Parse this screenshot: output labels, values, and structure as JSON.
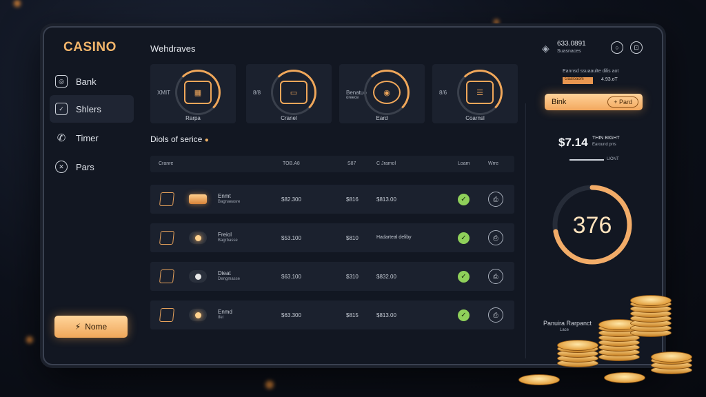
{
  "sidebar": {
    "brand": "CASINO",
    "items": [
      {
        "label": "Bank",
        "icon": "bank-icon"
      },
      {
        "label": "Shlers",
        "icon": "document-icon"
      },
      {
        "label": "Timer",
        "icon": "phone-icon"
      },
      {
        "label": "Pars",
        "icon": "tools-icon"
      }
    ],
    "home_button": {
      "label": "Nome",
      "icon": "bolt-icon"
    }
  },
  "header": {
    "title": "Wehdraves",
    "balance": "633.0891",
    "balance_sub": "Suasnaces"
  },
  "cards": [
    {
      "small": "XMIT",
      "caption": "Rarpa",
      "icon": "safe-icon"
    },
    {
      "small": "8/8",
      "caption": "Cranel",
      "icon": "card-icon"
    },
    {
      "small": "Benatuo",
      "small_sub": "oreece",
      "caption": "Eard",
      "icon": "piggy-icon"
    },
    {
      "small": "8/6",
      "caption": "Coarnsl",
      "icon": "wallet-icon"
    }
  ],
  "section_title": "Diols of serice",
  "table": {
    "headers": [
      "Cranre",
      "TOB.A8",
      "S87",
      "C Jramol",
      "Loam",
      "Wrre"
    ],
    "rows": [
      {
        "name": "Enmt",
        "name_sub": "Bagnaeasre",
        "amount": "$82.300",
        "fee": "$816",
        "detail": "$813.00"
      },
      {
        "name": "Freiol",
        "name_sub": "Bagrbasse",
        "amount": "$53.100",
        "fee": "$810",
        "detail": "Hadarteal deliby"
      },
      {
        "name": "Dieat",
        "name_sub": "Dengmasse",
        "amount": "$63.100",
        "fee": "$310",
        "detail": "$832.00"
      },
      {
        "name": "Enmd",
        "name_sub": "Ifel",
        "amount": "$63.300",
        "fee": "$815",
        "detail": "$813.00"
      }
    ]
  },
  "right_panel": {
    "note": "Eannsd ssuaaulte dilis aot",
    "pill_label": "Gaaloaom",
    "pill_value": "4.93.oT",
    "action_label": "Bink",
    "action_secondary": "+ Pard",
    "amount": "$7.14",
    "amount_label": "THIN BIGHT",
    "amount_sub": "Earound prrs",
    "slider_label": "LIONT",
    "gauge_value": "376",
    "gauge_fraction": 0.72,
    "footer_title": "Panuira Rarpanct",
    "footer_sub": "Lace"
  },
  "colors": {
    "accent": "#f0a75a",
    "success": "#8fd05a",
    "panel": "#1b212e"
  }
}
